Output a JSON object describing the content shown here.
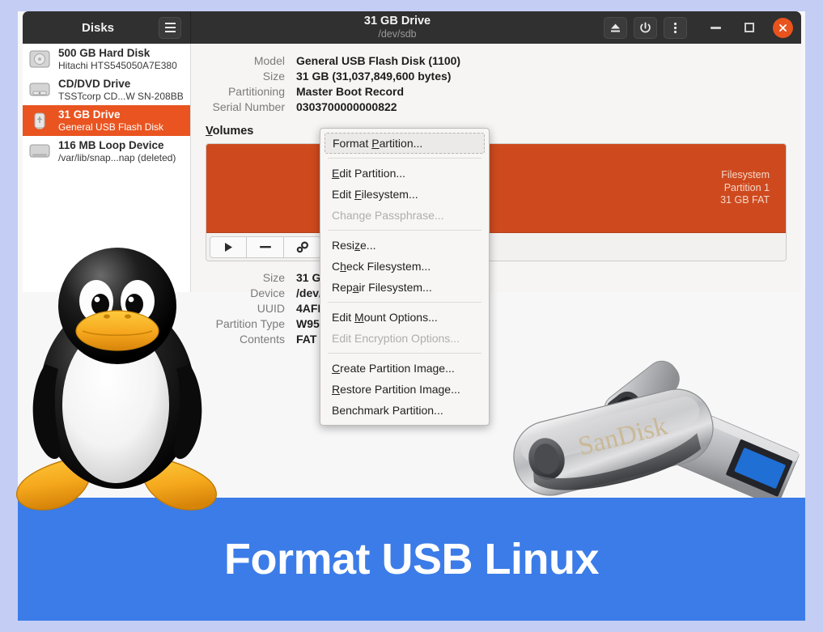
{
  "window": {
    "app_title": "Disks",
    "device_title": "31 GB Drive",
    "device_path": "/dev/sdb",
    "menu_button_icon": "hamburger-menu-icon",
    "eject_button_icon": "eject-icon",
    "power_button_icon": "power-icon",
    "more_button_icon": "kebab-menu-icon",
    "minimize_icon": "minimize-icon",
    "maximize_icon": "maximize-icon",
    "close_icon": "close-icon"
  },
  "sidebar": {
    "devices": [
      {
        "name": "500 GB Hard Disk",
        "sub": "Hitachi HTS545050A7E380",
        "icon": "hard-disk-icon",
        "selected": false
      },
      {
        "name": "CD/DVD Drive",
        "sub": "TSSTcorp CD...W SN-208BB",
        "icon": "optical-drive-icon",
        "selected": false
      },
      {
        "name": "31 GB Drive",
        "sub": "General USB Flash Disk",
        "icon": "usb-drive-icon",
        "selected": true
      },
      {
        "name": "116 MB Loop Device",
        "sub": "/var/lib/snap...nap (deleted)",
        "icon": "loop-device-icon",
        "selected": false
      }
    ]
  },
  "drive_info": [
    {
      "label": "Model",
      "value": "General USB Flash Disk (1100)"
    },
    {
      "label": "Size",
      "value": "31 GB (31,037,849,600 bytes)"
    },
    {
      "label": "Partitioning",
      "value": "Master Boot Record"
    },
    {
      "label": "Serial Number",
      "value": "0303700000000822"
    }
  ],
  "volumes": {
    "heading": "Volumes",
    "heading_mnemonic": "V",
    "bar_color": "#ce4a1e",
    "bar_lines": [
      "Filesystem",
      "Partition 1",
      "31 GB FAT"
    ],
    "toolbar": [
      {
        "icon": "play-mount-icon",
        "glyph": "▶",
        "name": "mount-volume-button"
      },
      {
        "icon": "minus-delete-icon",
        "glyph": "–",
        "name": "delete-volume-button"
      },
      {
        "icon": "gear-settings-icon",
        "glyph": "⛭",
        "name": "volume-options-button"
      }
    ]
  },
  "partition_details": [
    {
      "label": "Size",
      "value": "31 GB"
    },
    {
      "label": "Device",
      "value": "/dev/"
    },
    {
      "label": "UUID",
      "value": "4AFB-"
    },
    {
      "label": "Partition Type",
      "value": "W95 F"
    },
    {
      "label": "Contents",
      "value": "FAT (3"
    }
  ],
  "context_menu": {
    "items": [
      {
        "label": "Format Partition...",
        "mnemonic": "P",
        "state": "focused"
      },
      {
        "separator": true
      },
      {
        "label": "Edit Partition...",
        "mnemonic": "E",
        "state": "normal"
      },
      {
        "label": "Edit Filesystem...",
        "mnemonic": "F",
        "state": "normal"
      },
      {
        "label": "Change Passphrase...",
        "mnemonic": "",
        "state": "disabled"
      },
      {
        "separator": true
      },
      {
        "label": "Resize...",
        "mnemonic": "z",
        "state": "normal"
      },
      {
        "label": "Check Filesystem...",
        "mnemonic": "h",
        "state": "normal"
      },
      {
        "label": "Repair Filesystem...",
        "mnemonic": "a",
        "state": "normal"
      },
      {
        "separator": true
      },
      {
        "label": "Edit Mount Options...",
        "mnemonic": "M",
        "state": "normal"
      },
      {
        "label": "Edit Encryption Options...",
        "mnemonic": "",
        "state": "disabled"
      },
      {
        "separator": true
      },
      {
        "label": "Create Partition Image...",
        "mnemonic": "C",
        "state": "normal"
      },
      {
        "label": "Restore Partition Image...",
        "mnemonic": "R",
        "state": "normal"
      },
      {
        "label": "Benchmark Partition...",
        "mnemonic": "",
        "state": "normal"
      }
    ]
  },
  "banner": {
    "text": "Format USB Linux",
    "background": "#3b7ce8",
    "text_color": "#ffffff"
  },
  "decorations": {
    "tux_mascot": "linux-tux-penguin-image",
    "usb_drive": "sandisk-usb-flash-drive-image",
    "usb_brand_label": "SanDisk",
    "page_border_color": "#c4cdf4"
  }
}
